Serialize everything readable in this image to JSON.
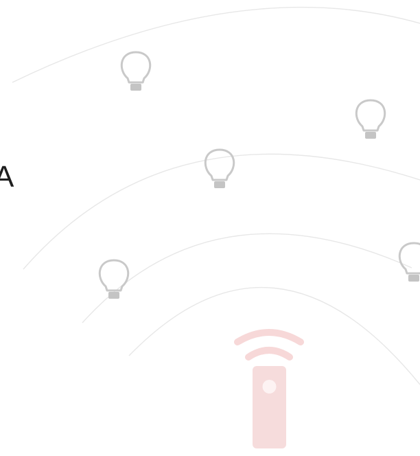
{
  "illustration": {
    "edge_text": "A",
    "icons": {
      "bulb": "lightbulb-icon",
      "remote": "remote-control-icon",
      "signal": "wireless-signal-icon"
    },
    "colors": {
      "arc": "#e6e6e6",
      "bulb_outline": "#c9c9c9",
      "bulb_base": "#c4c4c4",
      "remote": "#f6dcdc",
      "remote_signal": "#f7d8d8"
    }
  }
}
